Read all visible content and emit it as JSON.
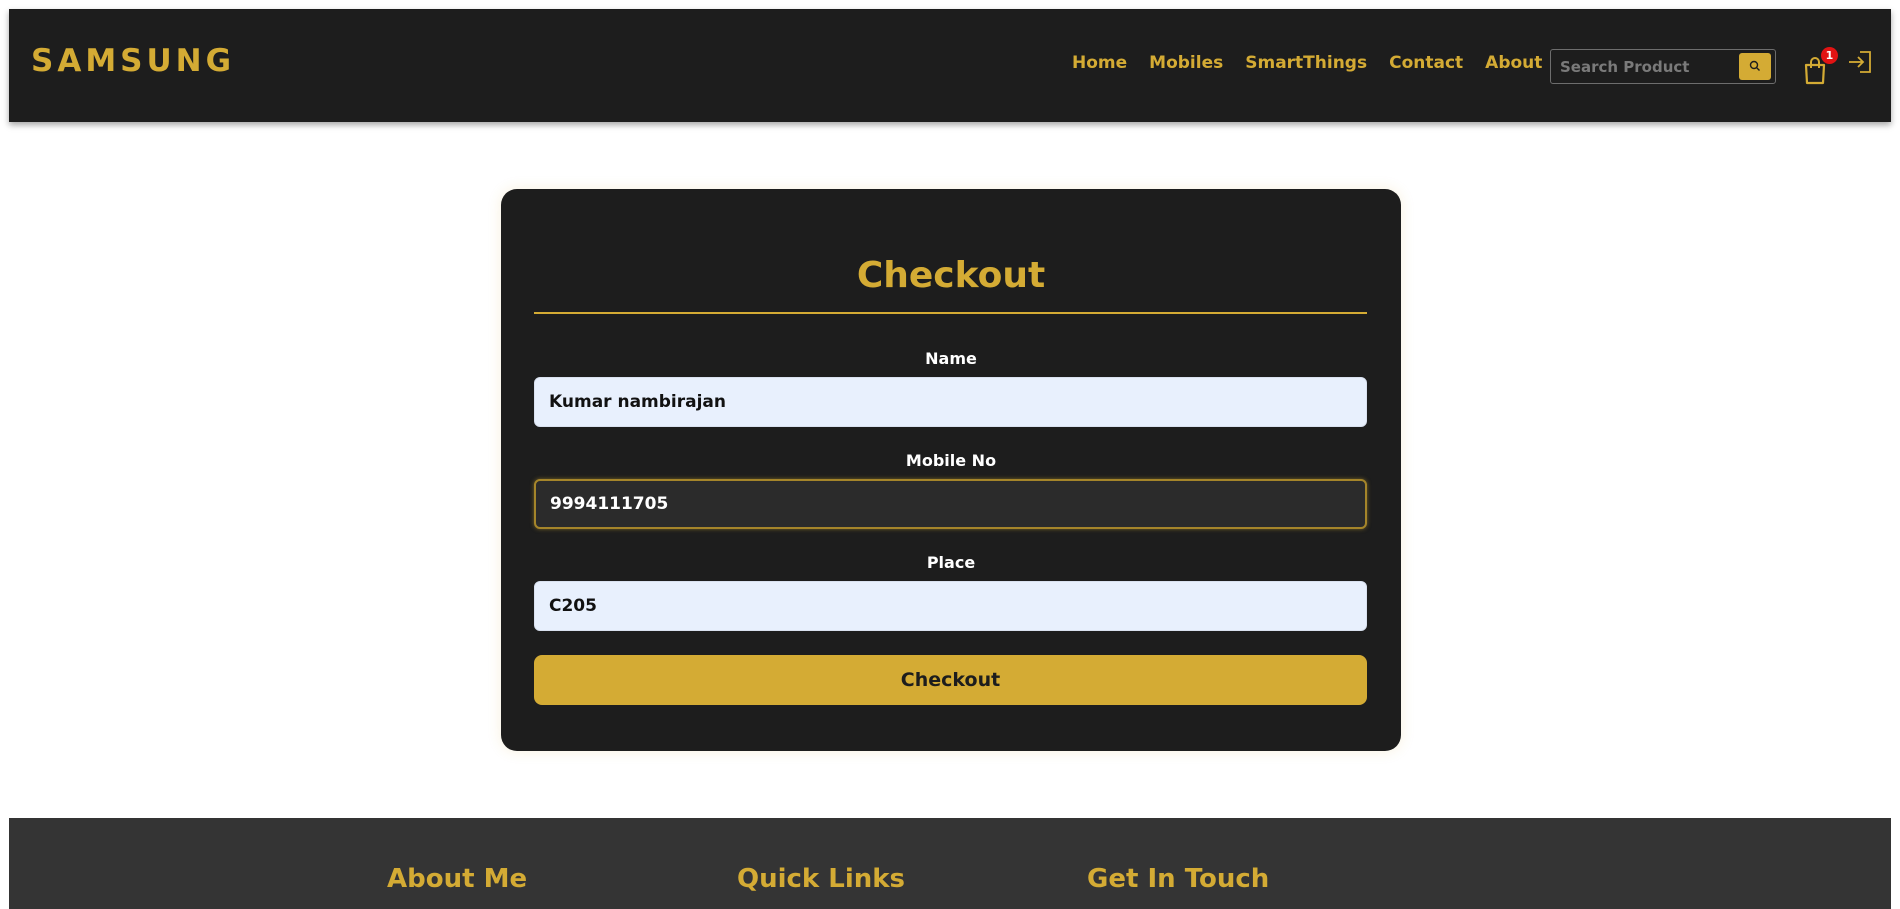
{
  "header": {
    "brand": "SAMSUNG",
    "nav": [
      "Home",
      "Mobiles",
      "SmartThings",
      "Contact",
      "About"
    ],
    "search_placeholder": "Search Product",
    "cart_count": "1",
    "icons": {
      "search": "search-icon",
      "cart": "shopping-bag-icon",
      "login": "login-icon"
    }
  },
  "checkout": {
    "title": "Checkout",
    "fields": {
      "name": {
        "label": "Name",
        "value": "Kumar nambirajan"
      },
      "mobile": {
        "label": "Mobile No",
        "value": "9994111705"
      },
      "place": {
        "label": "Place",
        "value": "C205"
      }
    },
    "submit_label": "Checkout"
  },
  "footer": {
    "headings": [
      "About Me",
      "Quick Links",
      "Get In Touch"
    ]
  },
  "colors": {
    "accent": "#d4ab34",
    "dark": "#1d1d1d",
    "footer_bg": "#343434",
    "badge": "#e21313"
  }
}
